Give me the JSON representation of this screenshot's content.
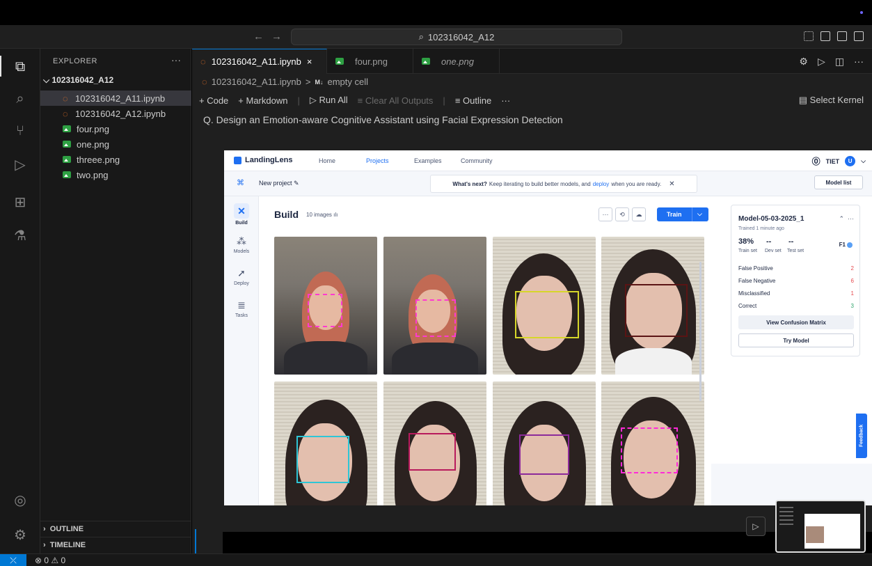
{
  "titlebar": {
    "command_center": "102316042_A12"
  },
  "sidebar": {
    "header": "EXPLORER",
    "folder": "102316042_A12",
    "files": [
      {
        "name": "102316042_A11.ipynb",
        "type": "notebook",
        "selected": true
      },
      {
        "name": "102316042_A12.ipynb",
        "type": "notebook",
        "selected": false
      },
      {
        "name": "four.png",
        "type": "image",
        "selected": false
      },
      {
        "name": "one.png",
        "type": "image",
        "selected": false
      },
      {
        "name": "threee.png",
        "type": "image",
        "selected": false
      },
      {
        "name": "two.png",
        "type": "image",
        "selected": false
      }
    ],
    "outline": "OUTLINE",
    "timeline": "TIMELINE"
  },
  "tabs": [
    {
      "label": "102316042_A11.ipynb",
      "close": "×",
      "active": true
    },
    {
      "label": "four.png",
      "active": false
    },
    {
      "label": "one.png",
      "active": false
    }
  ],
  "breadcrumb": {
    "file": "102316042_A11.ipynb",
    "sep": ">",
    "badge": "M↓",
    "cell": "empty cell"
  },
  "toolbar": {
    "code": "+ Code",
    "markdown": "+ Markdown",
    "run_all": "▷ Run All",
    "clear_outputs": "≡ Clear All Outputs",
    "outline": "≡ Outline",
    "more": "···",
    "select_kernel": "Select Kernel"
  },
  "question": "Q. Design an Emotion-aware Cognitive Assistant using Facial Expression Detection",
  "landinglens": {
    "logo": "LandingLens",
    "nav": [
      "Home",
      "Projects",
      "Examples",
      "Community"
    ],
    "active_nav": "Projects",
    "org": "TIET",
    "avatar": "U",
    "new_project": "New project",
    "banner_bold": "What's next?",
    "banner_text_1": "Keep iterating to build better models, and",
    "banner_link": "deploy",
    "banner_text_2": "when you are ready.",
    "model_list": "Model list",
    "left_nav": [
      "Build",
      "Models",
      "Deploy",
      "Tasks"
    ],
    "build_title": "Build",
    "image_count": "10 images",
    "train": "Train",
    "model_panel": {
      "name": "Model-05-03-2025_1",
      "trained": "Trained 1 minute ago",
      "train_set_value": "38%",
      "dev_set_value": "--",
      "test_set_value": "--",
      "train_set_label": "Train set",
      "dev_set_label": "Dev set",
      "test_set_label": "Test set",
      "metric": "F1",
      "rows": [
        {
          "label": "False Positive",
          "value": "2",
          "color": "#e5484d"
        },
        {
          "label": "False Negative",
          "value": "6",
          "color": "#e5484d"
        },
        {
          "label": "Misclassified",
          "value": "1",
          "color": "#e5484d"
        },
        {
          "label": "Correct",
          "value": "3",
          "color": "#30a46c"
        }
      ],
      "confusion_button": "View Confusion Matrix",
      "try_button": "Try Model"
    },
    "feedback": "Feedback"
  },
  "statusbar": {
    "problems": "⊗ 0 ⚠ 0"
  },
  "colors": {
    "accent": "#0078d4",
    "ll_blue": "#1e6ff1"
  }
}
